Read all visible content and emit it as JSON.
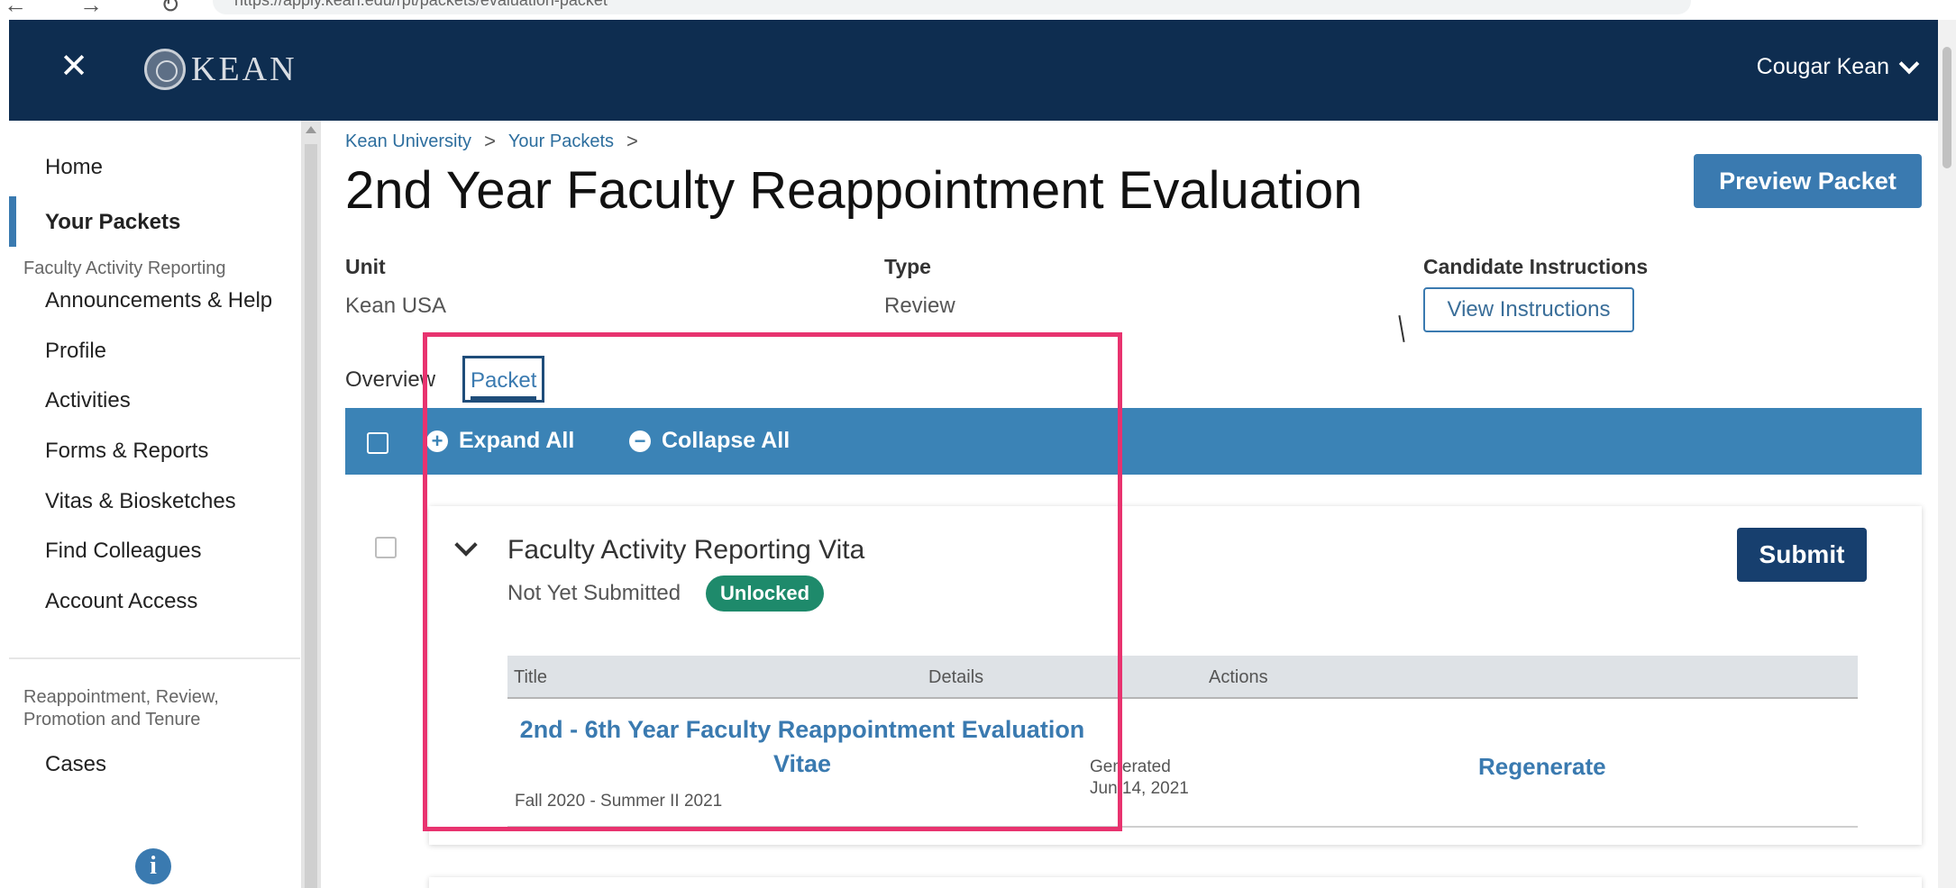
{
  "browser": {
    "url_text": "https://apply.kean.edu/rpt/packets/evaluation-packet"
  },
  "header": {
    "logo_text": "KEAN",
    "user_name": "Cougar Kean"
  },
  "sidebar": {
    "items": [
      {
        "label": "Home"
      },
      {
        "label": "Your Packets"
      },
      {
        "label": "Announcements & Help"
      },
      {
        "label": "Profile"
      },
      {
        "label": "Activities"
      },
      {
        "label": "Forms & Reports"
      },
      {
        "label": "Vitas & Biosketches"
      },
      {
        "label": "Find Colleagues"
      },
      {
        "label": "Account Access"
      },
      {
        "label": "Cases"
      }
    ],
    "groups": [
      {
        "label": "Faculty Activity Reporting"
      },
      {
        "label": "Reappointment, Review, Promotion and Tenure"
      }
    ]
  },
  "breadcrumb": {
    "items": [
      {
        "label": "Kean University"
      },
      {
        "label": "Your Packets"
      }
    ],
    "separator": ">"
  },
  "page": {
    "title": "2nd Year Faculty Reappointment Evaluation",
    "preview_button": "Preview Packet"
  },
  "meta": {
    "unit_label": "Unit",
    "unit_value": "Kean USA",
    "type_label": "Type",
    "type_value": "Review",
    "instructions_label": "Candidate Instructions",
    "instructions_button": "View Instructions"
  },
  "tabs": [
    {
      "label": "Overview",
      "active": false
    },
    {
      "label": "Packet",
      "active": true
    }
  ],
  "toolbar": {
    "expand_label": "Expand All",
    "collapse_label": "Collapse All"
  },
  "section": {
    "title": "Faculty Activity Reporting Vita",
    "status": "Not Yet Submitted",
    "badge": "Unlocked",
    "submit_label": "Submit",
    "table": {
      "headers": [
        "Title",
        "Details",
        "Actions"
      ],
      "rows": [
        {
          "title": "2nd - 6th Year Faculty Reappointment Evaluation Vitae",
          "subtitle": "Fall 2020 - Summer II 2021",
          "details_line1": "Generated",
          "details_line2": "Jun 14, 2021",
          "action": "Regenerate"
        }
      ]
    }
  },
  "colors": {
    "header_bg": "#0e2d50",
    "accent": "#3a7ab0",
    "badge_bg": "#1e8a6b",
    "submit_bg": "#173f6e",
    "highlight": "#e8336f"
  }
}
